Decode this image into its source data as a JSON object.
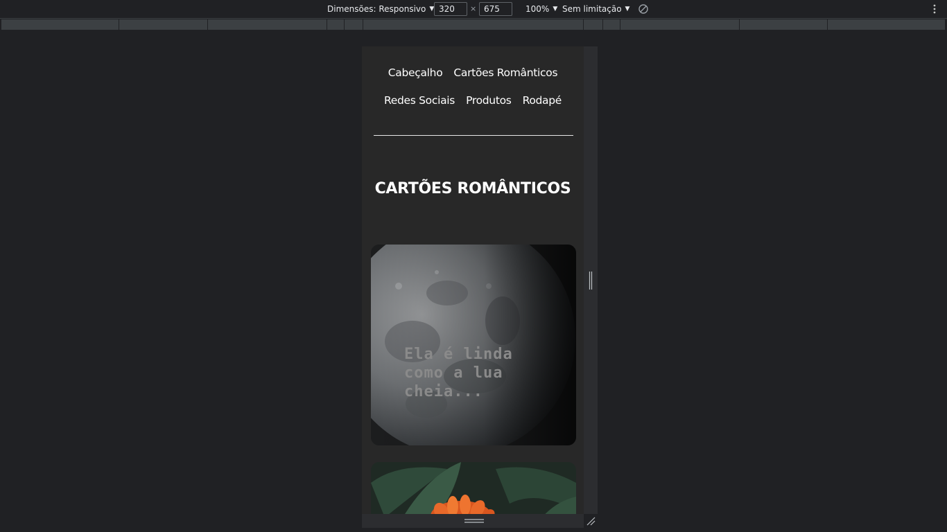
{
  "devtools_toolbar": {
    "dimensions_label": "Dimensões: Responsivo",
    "width_value": "320",
    "times_symbol": "×",
    "height_value": "675",
    "zoom_label": "100%",
    "throttle_label": "Sem limitação",
    "rotate_icon": "rotate-icon",
    "more_icon": "more-vertical-icon"
  },
  "page": {
    "nav": {
      "row1": [
        "Cabeçalho",
        "Cartões Românticos"
      ],
      "row2": [
        "Redes Sociais",
        "Produtos",
        "Rodapé"
      ]
    },
    "section_title": "CARTÕES ROMÂNTICOS",
    "cards": [
      {
        "caption": "Ela é linda\ncomo a lua\ncheia..."
      }
    ]
  },
  "colors": {
    "background": "#202124",
    "viewport_bg": "#282828",
    "text": "#ffffff",
    "caption": "#8a8a8a"
  }
}
